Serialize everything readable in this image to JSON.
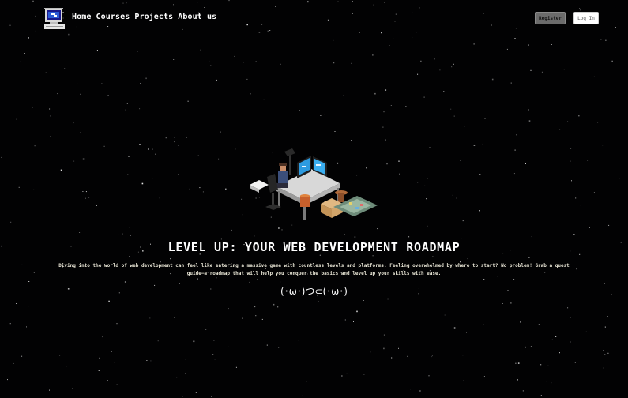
{
  "header": {
    "logo_icon": "retro-computer-icon",
    "nav": [
      "Home",
      "Courses",
      "Projects",
      "About us"
    ],
    "register_label": "Register",
    "login_label": "Log In"
  },
  "hero": {
    "illustration": "isometric-developer-desk-illustration",
    "title": "LEVEL UP: YOUR WEB DEVELOPMENT ROADMAP",
    "description_line1": "Diving into the world of web development can feel like entering a massive game with countless levels and platforms. Feeling overwhelmed by where to start? No problem! Grab a quest",
    "description_line2": "guide—a roadmap that will help you conquer the basics and level up your skills with ease.",
    "kaomoji": "(･ω･)つ⊂(･ω･)"
  },
  "colors": {
    "background": "#020203",
    "register_button": "#6b6b6b",
    "login_button": "#ffffff",
    "description_text": "#e9e6d6"
  }
}
